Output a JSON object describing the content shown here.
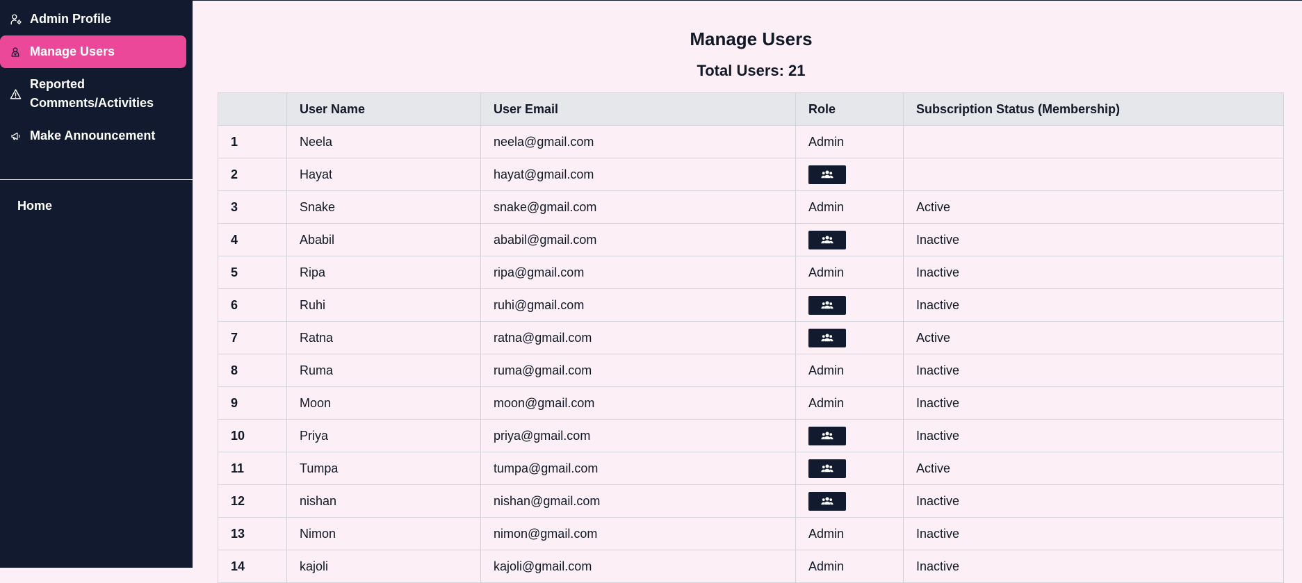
{
  "sidebar": {
    "items": [
      {
        "label": "Admin Profile",
        "icon": "user-cog-icon"
      },
      {
        "label": "Manage Users",
        "icon": "users-icon"
      },
      {
        "label": "Reported Comments/Activities",
        "icon": "warning-icon"
      },
      {
        "label": "Make Announcement",
        "icon": "megaphone-icon"
      }
    ],
    "home_label": "Home"
  },
  "main": {
    "title": "Manage Users",
    "total_users": "Total Users: 21"
  },
  "table": {
    "headers": [
      "",
      "User Name",
      "User Email",
      "Role",
      "Subscription Status (Membership)"
    ],
    "rows": [
      {
        "idx": "1",
        "name": "Neela",
        "email": "neela@gmail.com",
        "role": "Admin",
        "status": ""
      },
      {
        "idx": "2",
        "name": "Hayat",
        "email": "hayat@gmail.com",
        "role": "",
        "status": ""
      },
      {
        "idx": "3",
        "name": "Snake",
        "email": "snake@gmail.com",
        "role": "Admin",
        "status": "Active"
      },
      {
        "idx": "4",
        "name": "Ababil",
        "email": "ababil@gmail.com",
        "role": "",
        "status": "Inactive"
      },
      {
        "idx": "5",
        "name": "Ripa",
        "email": "ripa@gmail.com",
        "role": "Admin",
        "status": "Inactive"
      },
      {
        "idx": "6",
        "name": "Ruhi",
        "email": "ruhi@gmail.com",
        "role": "",
        "status": "Inactive"
      },
      {
        "idx": "7",
        "name": "Ratna",
        "email": "ratna@gmail.com",
        "role": "",
        "status": "Active"
      },
      {
        "idx": "8",
        "name": "Ruma",
        "email": "ruma@gmail.com",
        "role": "Admin",
        "status": "Inactive"
      },
      {
        "idx": "9",
        "name": "Moon",
        "email": "moon@gmail.com",
        "role": "Admin",
        "status": "Inactive"
      },
      {
        "idx": "10",
        "name": "Priya",
        "email": "priya@gmail.com",
        "role": "",
        "status": "Inactive"
      },
      {
        "idx": "11",
        "name": "Tumpa",
        "email": "tumpa@gmail.com",
        "role": "",
        "status": "Active"
      },
      {
        "idx": "12",
        "name": "nishan",
        "email": "nishan@gmail.com",
        "role": "",
        "status": "Inactive"
      },
      {
        "idx": "13",
        "name": "Nimon",
        "email": "nimon@gmail.com",
        "role": "Admin",
        "status": "Inactive"
      },
      {
        "idx": "14",
        "name": "kajoli",
        "email": "kajoli@gmail.com",
        "role": "Admin",
        "status": "Inactive"
      }
    ],
    "make_admin_icon": "users-icon"
  },
  "colors": {
    "sidebar_bg": "#111a2e",
    "active_item_bg": "#ec4899",
    "page_bg": "#fcf0f6",
    "header_bg": "#e5e7eb"
  }
}
